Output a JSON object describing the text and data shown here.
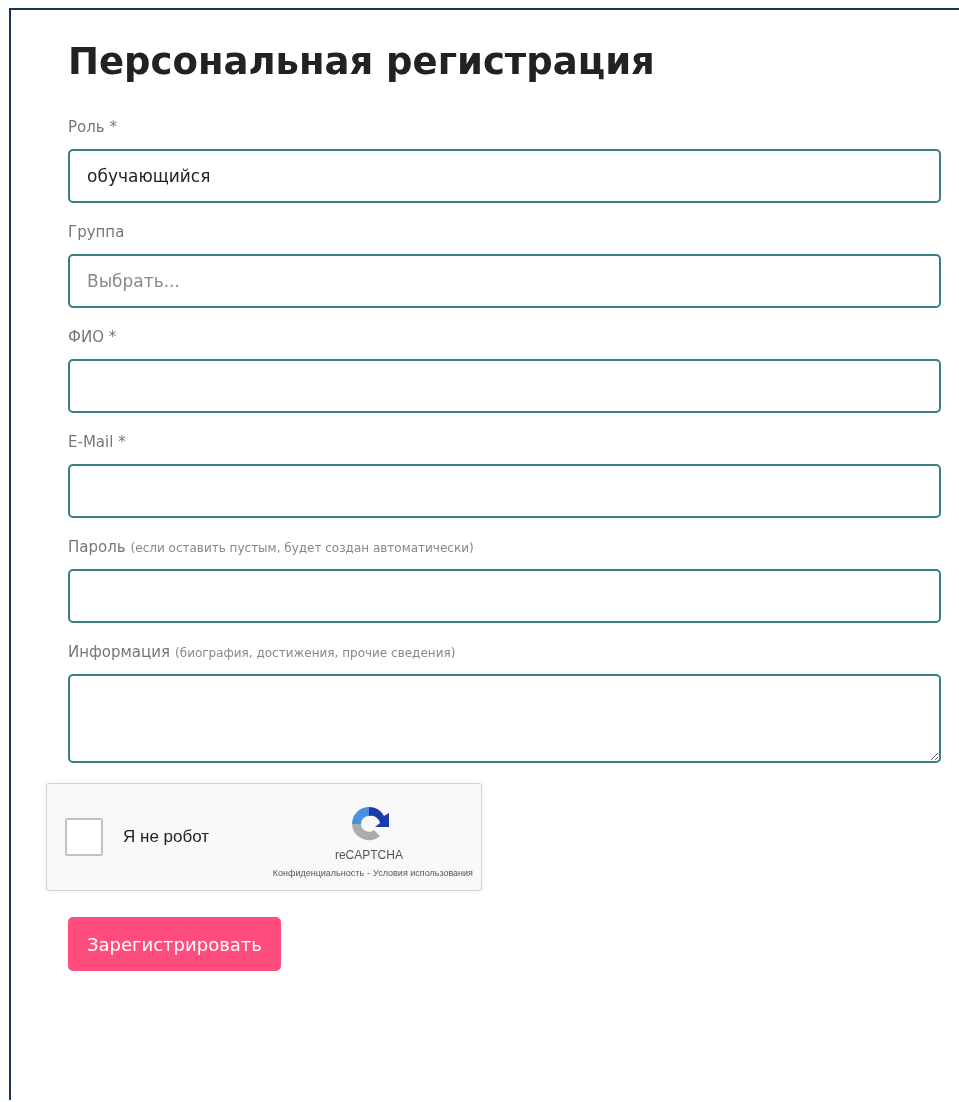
{
  "title": "Персональная регистрация",
  "fields": [
    {
      "kind": "input",
      "label": "Роль *",
      "value": "обучающийся"
    },
    {
      "kind": "input",
      "label": "Группа",
      "placeholder": "Выбрать..."
    },
    {
      "kind": "input",
      "label": "ФИО *"
    },
    {
      "kind": "input",
      "label": "E-Mail *"
    },
    {
      "kind": "input",
      "label": "Пароль",
      "hint": "(если оставить пустым, будет создан автоматически)"
    },
    {
      "kind": "textarea",
      "label": "Информация",
      "hint": "(биография, достижения, прочие сведения)"
    }
  ],
  "captcha": {
    "label": "Я не робот",
    "checked": false,
    "brand": "reCAPTCHA",
    "links": [
      "Конфиденциальность",
      "Условия использования"
    ],
    "separator": "-"
  },
  "submit": "Зарегистрировать"
}
